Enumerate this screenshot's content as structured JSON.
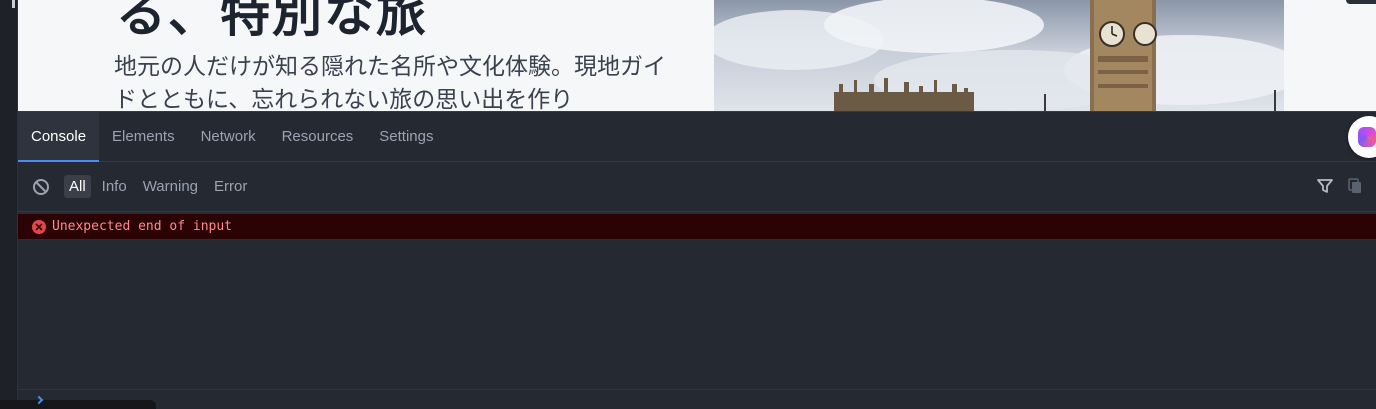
{
  "preview": {
    "hero_title": "る、特別な旅",
    "hero_description": "地元の人だけが知る隠れた名所や文化体験。現地ガイドとともに、忘れられない旅の思い出を作り"
  },
  "devtools": {
    "tabs": [
      {
        "label": "Console",
        "active": true
      },
      {
        "label": "Elements",
        "active": false
      },
      {
        "label": "Network",
        "active": false
      },
      {
        "label": "Resources",
        "active": false
      },
      {
        "label": "Settings",
        "active": false
      }
    ],
    "levels": [
      {
        "label": "All",
        "active": true
      },
      {
        "label": "Info",
        "active": false
      },
      {
        "label": "Warning",
        "active": false
      },
      {
        "label": "Error",
        "active": false
      }
    ],
    "messages": [
      {
        "type": "error",
        "text": "Unexpected end of input"
      }
    ]
  },
  "colors": {
    "accent": "#4b8df8",
    "error_bg": "#2b0305",
    "error_text": "#ff8a8e",
    "panel_bg": "#252932"
  },
  "icons": {
    "clear": "clear-console-icon",
    "filter": "filter-icon",
    "copy": "copy-icon",
    "error": "error-icon"
  }
}
